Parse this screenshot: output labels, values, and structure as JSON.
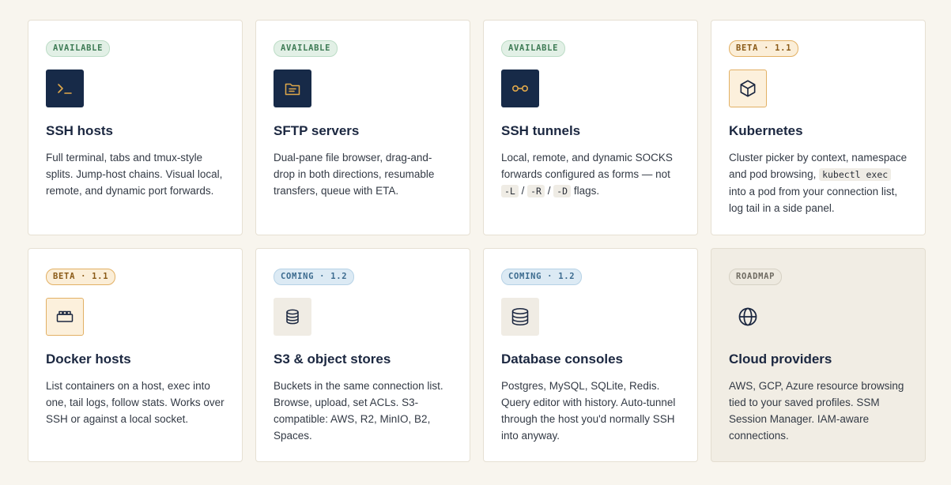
{
  "cards": [
    {
      "badge": "AVAILABLE",
      "title": "SSH hosts",
      "desc": "Full terminal, tabs and tmux-style splits. Jump-host chains. Visual local, remote, and dynamic port forwards."
    },
    {
      "badge": "AVAILABLE",
      "title": "SFTP servers",
      "desc": "Dual-pane file browser, drag-and-drop in both directions, resumable transfers, queue with ETA."
    },
    {
      "badge": "AVAILABLE",
      "title": "SSH tunnels",
      "desc_before": "Local, remote, and dynamic SOCKS forwards configured as forms — not ",
      "code1": "-L",
      "sep1": " / ",
      "code2": "-R",
      "sep2": " / ",
      "code3": "-D",
      "desc_after": " flags."
    },
    {
      "badge": "BETA · 1.1",
      "title": "Kubernetes",
      "desc_before": "Cluster picker by context, namespace and pod browsing, ",
      "code1": "kubectl exec",
      "desc_after": " into a pod from your connection list, log tail in a side panel."
    },
    {
      "badge": "BETA · 1.1",
      "title": "Docker hosts",
      "desc": "List containers on a host, exec into one, tail logs, follow stats. Works over SSH or against a local socket."
    },
    {
      "badge": "COMING · 1.2",
      "title": "S3 & object stores",
      "desc": "Buckets in the same connection list. Browse, upload, set ACLs. S3-compatible: AWS, R2, MinIO, B2, Spaces."
    },
    {
      "badge": "COMING · 1.2",
      "title": "Database consoles",
      "desc": "Postgres, MySQL, SQLite, Redis. Query editor with history. Auto-tunnel through the host you'd normally SSH into anyway."
    },
    {
      "badge": "ROADMAP",
      "title": "Cloud providers",
      "desc": "AWS, GCP, Azure resource browsing tied to your saved profiles. SSM Session Manager. IAM-aware connections."
    }
  ],
  "icons": [
    "terminal-icon",
    "folder-icon",
    "tunnel-icon",
    "cube-icon",
    "container-icon",
    "bucket-icon",
    "database-icon",
    "globe-icon"
  ],
  "colors": {
    "navy": "#172a48",
    "accent": "#e0a84a",
    "available": "#3e7b55",
    "beta": "#8a5a17",
    "coming": "#3c6b8f",
    "roadmap": "#6f6b62",
    "background": "#f8f5ee"
  }
}
